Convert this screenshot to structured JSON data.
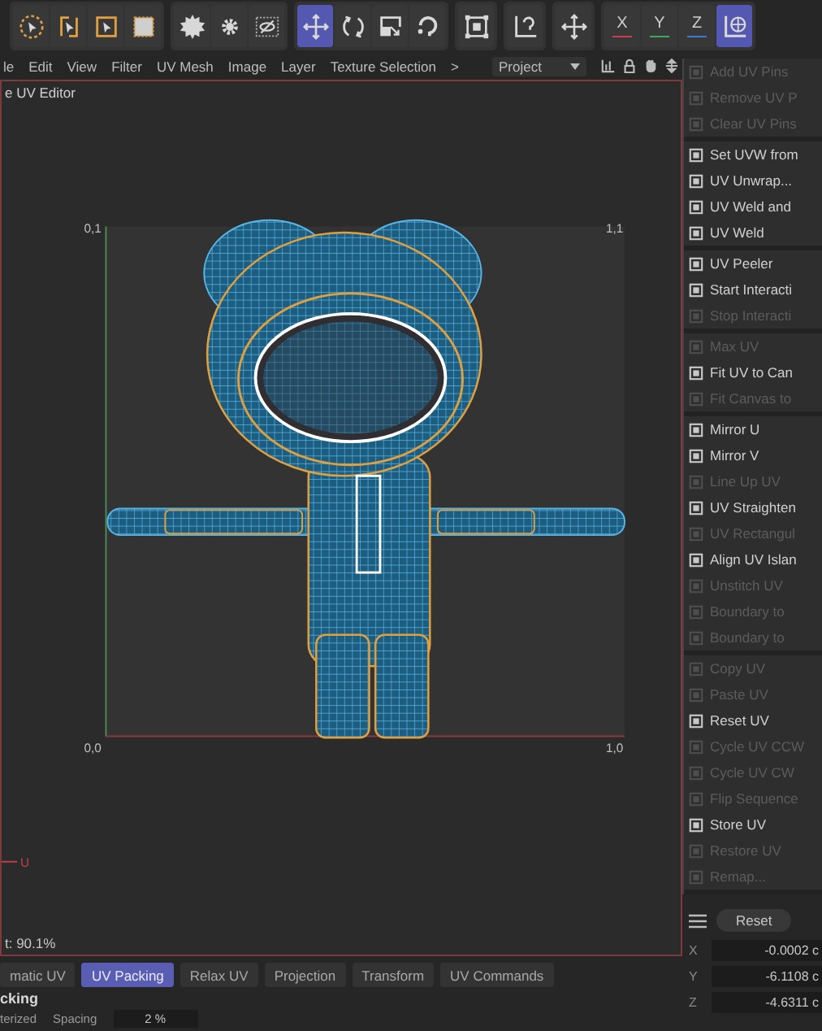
{
  "toolbar": [
    {
      "tools": [
        {
          "kind": "icon",
          "selected": false
        },
        {
          "kind": "icon",
          "selected": false
        },
        {
          "kind": "icon",
          "selected": false
        },
        {
          "kind": "icon",
          "selected": false
        }
      ]
    },
    {
      "tools": [
        {
          "kind": "icon",
          "selected": false
        },
        {
          "kind": "icon",
          "selected": false
        },
        {
          "kind": "icon",
          "selected": false
        }
      ]
    },
    {
      "tools": [
        {
          "kind": "icon",
          "selected": true
        },
        {
          "kind": "icon",
          "selected": false
        },
        {
          "kind": "icon",
          "selected": false
        },
        {
          "kind": "icon",
          "selected": false
        }
      ]
    },
    {
      "tools": [
        {
          "kind": "icon",
          "selected": false
        }
      ]
    },
    {
      "tools": [
        {
          "kind": "icon",
          "selected": false
        }
      ]
    },
    {
      "tools": [
        {
          "kind": "icon",
          "selected": false
        }
      ]
    },
    {
      "tools": [
        {
          "kind": "axis",
          "label": "X",
          "color": "#c8404c",
          "selected": false
        },
        {
          "kind": "axis",
          "label": "Y",
          "color": "#40a860",
          "selected": false
        },
        {
          "kind": "axis",
          "label": "Z",
          "color": "#3c7cd0",
          "selected": false
        },
        {
          "kind": "icon",
          "selected": true
        }
      ]
    }
  ],
  "menu": [
    "le",
    "Edit",
    "View",
    "Filter",
    "UV Mesh",
    "Image",
    "Layer",
    "Texture Selection",
    ">"
  ],
  "layer_dropdown": {
    "value": "Project"
  },
  "editor": {
    "title": "e UV Editor",
    "corner_labels": [
      "0,1",
      "1,1",
      "0,0",
      "1,0"
    ],
    "axis_label": "U",
    "status": "t: 90.1%"
  },
  "commands": [
    {
      "items": [
        {
          "label": "Add UV Pins",
          "disabled": true
        },
        {
          "label": "Remove UV P",
          "disabled": true
        },
        {
          "label": "Clear UV Pins",
          "disabled": true
        }
      ]
    },
    {
      "items": [
        {
          "label": "Set UVW from",
          "disabled": false
        },
        {
          "label": "UV Unwrap...",
          "disabled": false
        },
        {
          "label": "UV Weld and",
          "disabled": false
        },
        {
          "label": "UV Weld",
          "disabled": false
        }
      ]
    },
    {
      "items": [
        {
          "label": "UV Peeler",
          "disabled": false
        },
        {
          "label": "Start Interacti",
          "disabled": false
        },
        {
          "label": "Stop Interacti",
          "disabled": true
        }
      ]
    },
    {
      "items": [
        {
          "label": "Max UV",
          "disabled": true
        },
        {
          "label": "Fit UV to Can",
          "disabled": false
        },
        {
          "label": "Fit Canvas to",
          "disabled": true
        }
      ]
    },
    {
      "items": [
        {
          "label": "Mirror U",
          "disabled": false
        },
        {
          "label": "Mirror V",
          "disabled": false
        },
        {
          "label": "Line Up UV",
          "disabled": true
        },
        {
          "label": "UV Straighten",
          "disabled": false
        },
        {
          "label": "UV Rectangul",
          "disabled": true
        },
        {
          "label": "Align UV Islan",
          "disabled": false
        },
        {
          "label": "Unstitch UV",
          "disabled": true
        },
        {
          "label": "Boundary to",
          "disabled": true
        },
        {
          "label": "Boundary to",
          "disabled": true
        }
      ]
    },
    {
      "items": [
        {
          "label": "Copy UV",
          "disabled": true
        },
        {
          "label": "Paste UV",
          "disabled": true
        },
        {
          "label": "Reset UV",
          "disabled": false
        },
        {
          "label": "Cycle UV CCW",
          "disabled": true
        },
        {
          "label": "Cycle UV CW",
          "disabled": true
        },
        {
          "label": "Flip Sequence",
          "disabled": true
        },
        {
          "label": "Store UV",
          "disabled": false
        },
        {
          "label": "Restore UV",
          "disabled": true
        },
        {
          "label": "Remap...",
          "disabled": true
        }
      ]
    }
  ],
  "transform": {
    "reset": "Reset",
    "fields": [
      {
        "axis": "X",
        "value": "-0.0002 c"
      },
      {
        "axis": "Y",
        "value": "-6.1108 c"
      },
      {
        "axis": "Z",
        "value": "-4.6311 c"
      }
    ]
  },
  "bottom_tabs": [
    {
      "label": "matic UV",
      "selected": false
    },
    {
      "label": "UV Packing",
      "selected": true
    },
    {
      "label": "Relax UV",
      "selected": false
    },
    {
      "label": "Projection",
      "selected": false
    },
    {
      "label": "Transform",
      "selected": false
    },
    {
      "label": "UV Commands",
      "selected": false
    }
  ],
  "packing": {
    "heading": "cking",
    "option": "terized",
    "spacing_label": "Spacing",
    "spacing_value": "2 %"
  }
}
